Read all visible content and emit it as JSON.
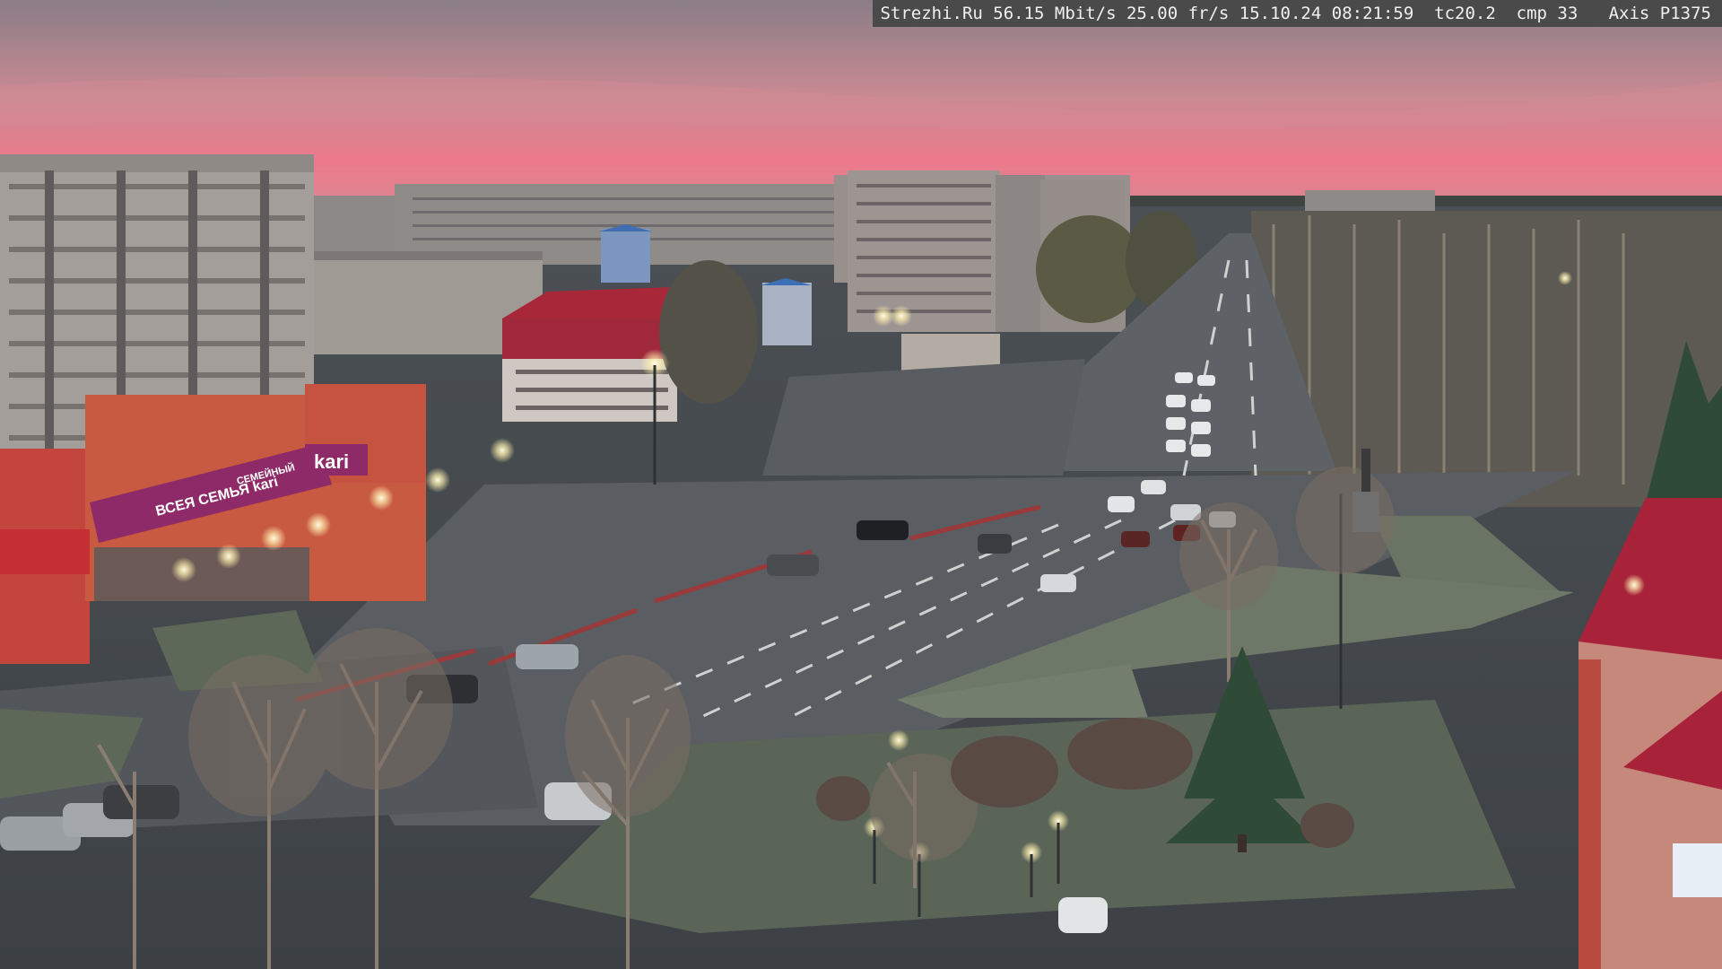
{
  "overlay": {
    "text": "Strezhi.Ru 56.15 Mbit/s 25.00 fr/s 15.10.24 08:21:59  tc20.2  cmp 33   Axis P1375"
  },
  "signs": {
    "store_brand": "kari",
    "store_banner": "ВСЕЯ СЕМЬЯ kari",
    "store_banner_short": "СЕМЕЙНЫЙ"
  },
  "colors": {
    "sky_top": "#8d7f86",
    "sky_glow": "#e8788a",
    "road": "#5a5d61",
    "grass": "#5f6a5c",
    "store_facade": "#c8553e",
    "store_banner": "#8e2a67",
    "tower_red": "#a8233a"
  }
}
